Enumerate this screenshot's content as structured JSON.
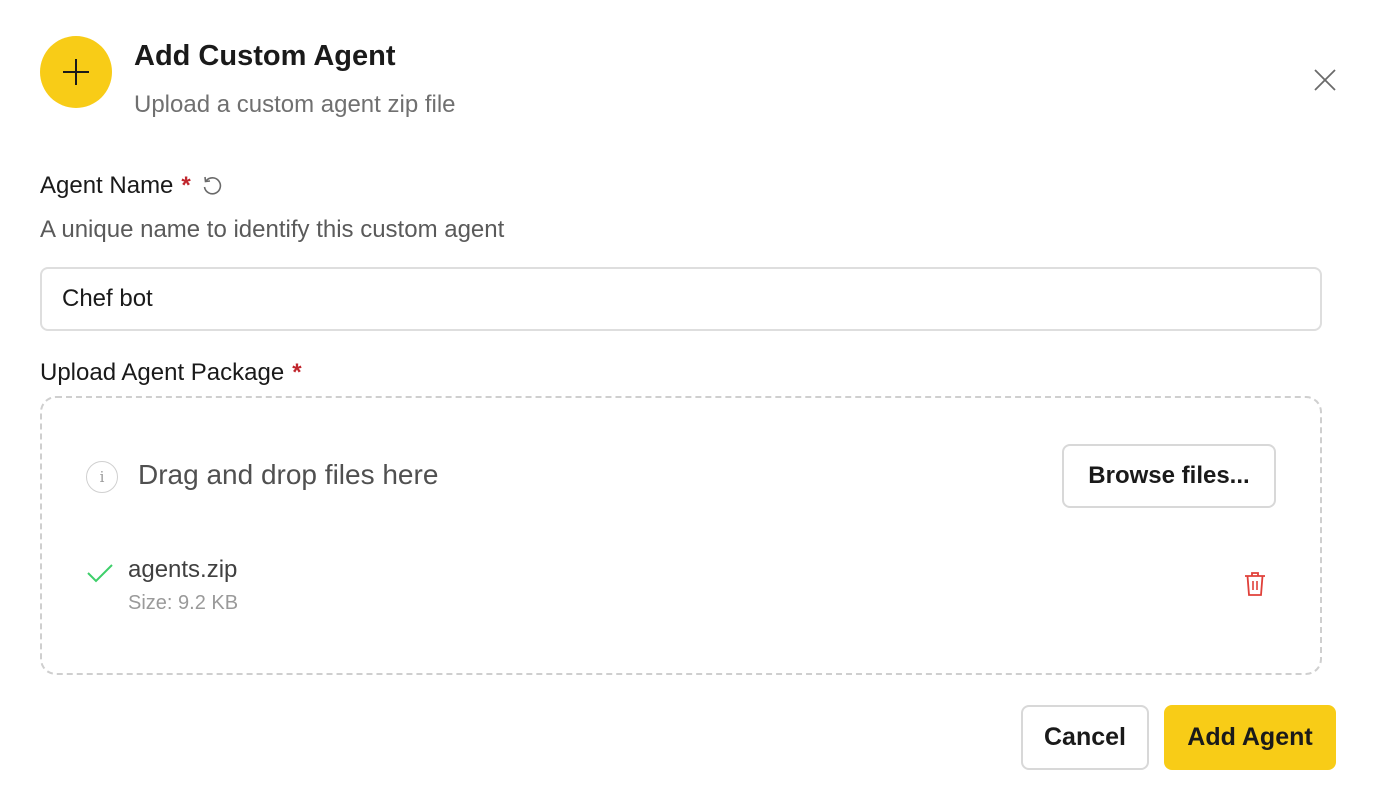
{
  "header": {
    "icon": "plus-icon",
    "title": "Add Custom Agent",
    "subtitle": "Upload a custom agent zip file",
    "close_icon": "close-icon"
  },
  "agent_name": {
    "label": "Agent Name",
    "required_marker": "*",
    "reset_icon": "reset-icon",
    "help_text": "A unique name to identify this custom agent",
    "value": "Chef bot"
  },
  "upload": {
    "label": "Upload Agent Package",
    "required_marker": "*",
    "info_icon": "info-icon",
    "drop_text": "Drag and drop files here",
    "browse_label": "Browse files...",
    "file": {
      "status_icon": "check-icon",
      "name": "agents.zip",
      "size": "Size: 9.2 KB",
      "delete_icon": "trash-icon"
    }
  },
  "footer": {
    "cancel_label": "Cancel",
    "submit_label": "Add Agent"
  },
  "colors": {
    "accent": "#f8cc17",
    "required": "#c0262d",
    "success": "#3ecf6a",
    "danger": "#e0403a"
  }
}
